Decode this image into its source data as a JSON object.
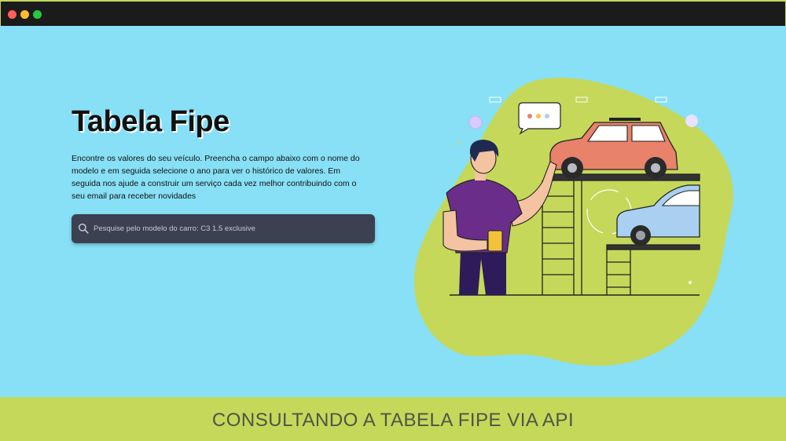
{
  "window": {
    "controls": [
      "close",
      "minimize",
      "maximize"
    ],
    "colors": {
      "close": "#ff5f57",
      "minimize": "#febc2e",
      "maximize": "#28c840"
    }
  },
  "hero": {
    "title": "Tabela Fipe",
    "description": "Encontre os valores do seu veículo. Preencha o campo abaixo com o nome do modelo e em seguida selecione o ano para ver o histórico de valores. Em seguida nos ajude a construir um serviço cada vez melhor contribuindo com o seu email para receber novidades",
    "search": {
      "placeholder": "Pesquise pelo modelo do carro: C3 1.5 exclusive",
      "value": "",
      "icon": "search-icon"
    },
    "illustration": {
      "subject": "person-with-cars-on-lifts",
      "colors": {
        "blob": "#c5d85a",
        "car_front": "#e8826a",
        "car_back": "#a9d0f1",
        "shirt": "#6a2d8a"
      }
    }
  },
  "footer": {
    "text": "CONSULTANDO A TABELA FIPE VIA API"
  },
  "colors": {
    "background": "#87e0f5",
    "accent": "#c5d85a",
    "search_bg": "#3b4150",
    "titlebar": "#1b1b1b"
  }
}
